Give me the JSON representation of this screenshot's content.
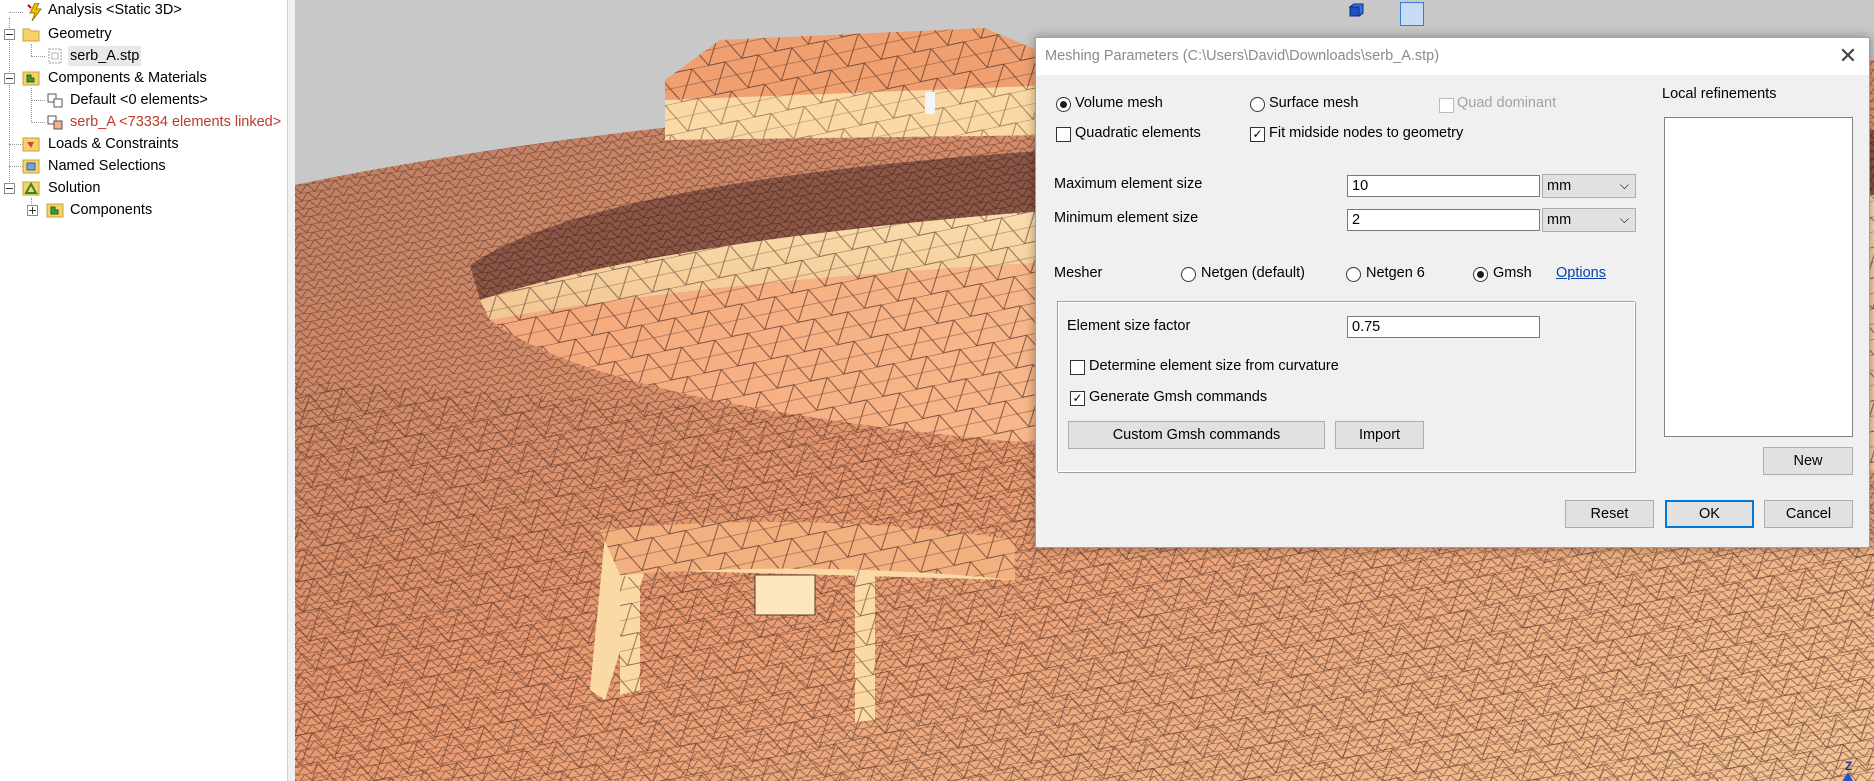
{
  "tree": {
    "items": [
      {
        "label": "Analysis <Static 3D>",
        "icon": "analysis-bolt-icon"
      },
      {
        "label": "Geometry",
        "icon": "folder-icon",
        "expander": "minus"
      },
      {
        "label": "serb_A.stp",
        "icon": "step-file-icon"
      },
      {
        "label": "Components & Materials",
        "icon": "components-icon",
        "expander": "minus"
      },
      {
        "label": "Default <0 elements>",
        "icon": "component-node-icon"
      },
      {
        "label": "serb_A <73334 elements linked>",
        "icon": "component-node-icon",
        "color": "#c0392b"
      },
      {
        "label": "Loads & Constraints",
        "icon": "loads-icon"
      },
      {
        "label": "Named Selections",
        "icon": "named-selections-icon"
      },
      {
        "label": "Solution",
        "icon": "solution-icon",
        "expander": "minus"
      },
      {
        "label": "Components",
        "icon": "components-icon",
        "expander": "plus"
      }
    ]
  },
  "viewport": {
    "tools": [
      "view-front-icon",
      "view-side-icon",
      "view-iso-icon"
    ],
    "axis_label": "Z",
    "mesh_color": "#f0a878",
    "mesh_light_color": "#fbd9a4",
    "mesh_dark_color": "#7a4a3c"
  },
  "dialog": {
    "title": "Meshing Parameters (C:\\Users\\David\\Downloads\\serb_A.stp)",
    "volume_mesh": "Volume mesh",
    "surface_mesh": "Surface mesh",
    "quad_dominant": "Quad dominant",
    "quadratic_elements": "Quadratic elements",
    "fit_midside": "Fit midside nodes to geometry",
    "max_size_label": "Maximum element size",
    "max_size_value": "10",
    "max_size_unit": "mm",
    "min_size_label": "Minimum element size",
    "min_size_value": "2",
    "min_size_unit": "mm",
    "mesher_label": "Mesher",
    "mesher_netgen_default": "Netgen (default)",
    "mesher_netgen6": "Netgen 6",
    "mesher_gmsh": "Gmsh",
    "options_link": "Options",
    "size_factor_label": "Element size factor",
    "size_factor_value": "0.75",
    "curvature_label": "Determine element size from curvature",
    "gen_gmsh_label": "Generate Gmsh commands",
    "custom_gmsh_button": "Custom Gmsh commands",
    "import_button": "Import",
    "local_refinements_label": "Local refinements",
    "new_button": "New",
    "reset_button": "Reset",
    "ok_button": "OK",
    "cancel_button": "Cancel",
    "close_glyph": "✕",
    "check_glyph": "✓"
  }
}
